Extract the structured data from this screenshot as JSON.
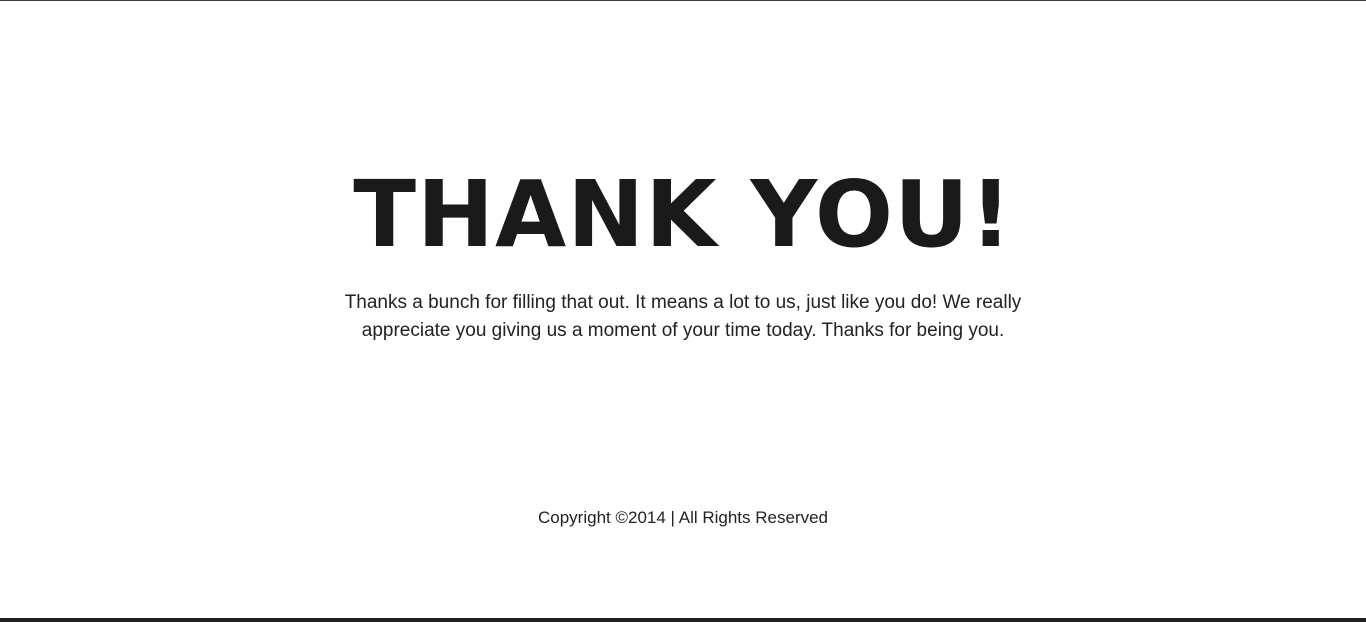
{
  "page": {
    "headline": "THANK YOU!",
    "message": "Thanks a bunch for filling that out. It means a lot to us, just like you do! We really appreciate you giving us a moment of your time today. Thanks for being you.",
    "footer": "Copyright ©2014 | All Rights Reserved"
  },
  "colors": {
    "background": "#ffffff",
    "text": "#1a1a1a",
    "border": "#1f1f1f"
  }
}
